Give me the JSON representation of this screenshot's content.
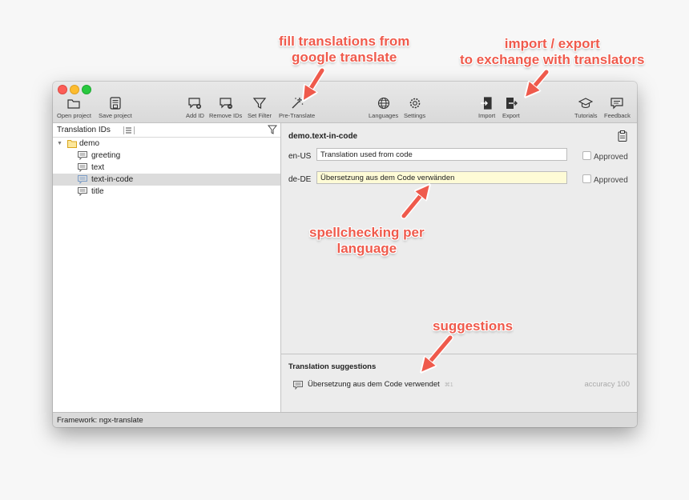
{
  "toolbar": {
    "open_project": "Open project",
    "save_project": "Save project",
    "add_id": "Add ID",
    "remove_ids": "Remove IDs",
    "set_filter": "Set Filter",
    "pre_translate": "Pre-Translate",
    "languages": "Languages",
    "settings": "Settings",
    "import": "Import",
    "export": "Export",
    "tutorials": "Tutorials",
    "feedback": "Feedback"
  },
  "sidebar": {
    "header": "Translation IDs",
    "tree": [
      {
        "label": "demo",
        "type": "folder",
        "expanded": true
      },
      {
        "label": "greeting",
        "type": "id"
      },
      {
        "label": "text",
        "type": "id"
      },
      {
        "label": "text-in-code",
        "type": "id",
        "selected": true
      },
      {
        "label": "title",
        "type": "id"
      }
    ]
  },
  "editor": {
    "title": "demo.text-in-code",
    "rows": [
      {
        "lang": "en-US",
        "value": "Translation used from code",
        "approved_label": "Approved"
      },
      {
        "lang": "de-DE",
        "value": "Übersetzung aus dem Code verwänden",
        "approved_label": "Approved"
      }
    ]
  },
  "suggestions": {
    "title": "Translation suggestions",
    "items": [
      {
        "text": "Übersetzung aus dem Code verwendet",
        "shortcut": "⌘1",
        "accuracy": "accuracy 100"
      }
    ]
  },
  "status": {
    "text": "Framework: ngx-translate"
  },
  "annotations": {
    "fill_line1": "fill translations from",
    "fill_line2": "google translate",
    "import_line1": "import / export",
    "import_line2": "to exchange with translators",
    "spell_line1": "spellchecking per",
    "spell_line2": "language",
    "suggestions": "suggestions"
  },
  "colors": {
    "callout": "#ef5a4c",
    "selection": "#dcdcdc",
    "input_highlight": "#fefbd6"
  }
}
